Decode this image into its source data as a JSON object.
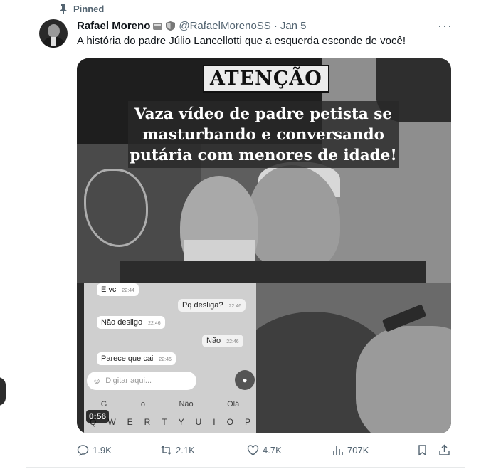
{
  "pinned_label": "Pinned",
  "author": {
    "name": "Rafael Moreno",
    "handle": "@RafaelMorenoSS",
    "separator": "·",
    "date": "Jan 5"
  },
  "tweet": {
    "text": "A história do padre Júlio Lancellotti que a esquerda esconde de você!"
  },
  "media": {
    "banner": "ATENÇÃO",
    "headline_lines": [
      "Vaza vídeo de padre petista se",
      "masturbando e conversando",
      "putária com menores de idade!"
    ],
    "duration": "0:56",
    "chat": {
      "messages": [
        {
          "text": "E vc",
          "time": "22:44",
          "dir": "in"
        },
        {
          "text": "Pq desliga?",
          "time": "22:46",
          "dir": "out"
        },
        {
          "text": "Não desligo",
          "time": "22:46",
          "dir": "in"
        },
        {
          "text": "Não",
          "time": "22:46",
          "dir": "out"
        },
        {
          "text": "Parece que cai",
          "time": "22:46",
          "dir": "in"
        }
      ],
      "compose_placeholder": "Digitar aqui...",
      "suggestions": [
        "G",
        "o",
        "Não",
        "Olá"
      ],
      "keyboard_row": [
        "Q",
        "W",
        "E",
        "R",
        "T",
        "Y",
        "U",
        "I",
        "O",
        "P"
      ]
    }
  },
  "actions": {
    "replies": "1.9K",
    "reposts": "2.1K",
    "likes": "4.7K",
    "views": "707K"
  }
}
